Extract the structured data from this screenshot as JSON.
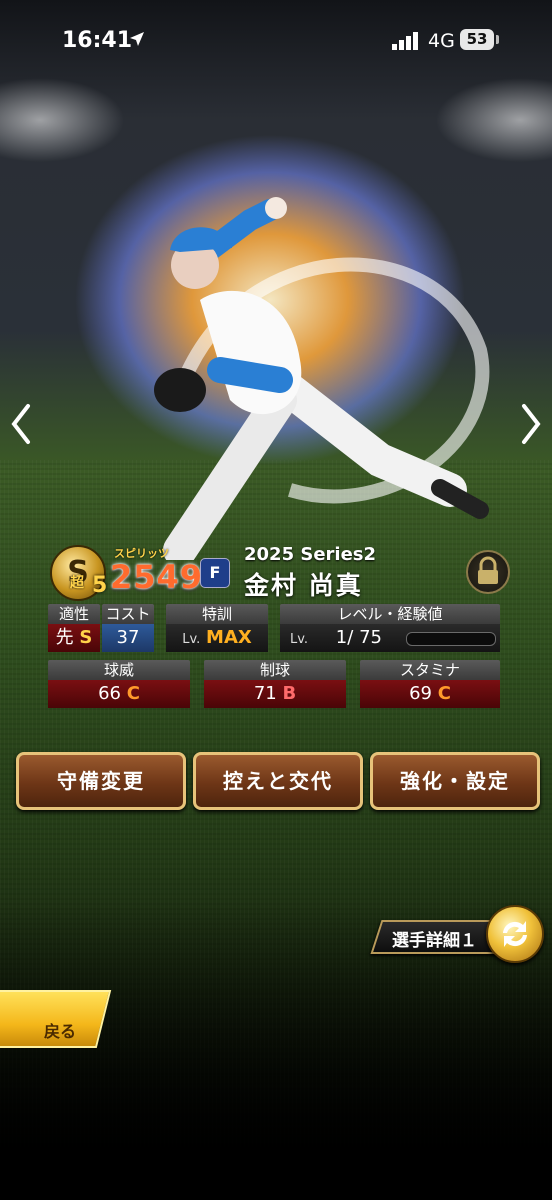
{
  "status_bar": {
    "time": "16:41",
    "network": "4G",
    "battery": "53"
  },
  "card": {
    "rank_letter": "S",
    "rank_sub": "超",
    "rank_number": "5",
    "spirits_label": "スピリッツ",
    "spirits_value": "2549",
    "team_logo": "F",
    "series": "2025 Series2",
    "player_name": "金村 尚真"
  },
  "stats": {
    "aptitude": {
      "label": "適性",
      "position": "先",
      "grade": "S"
    },
    "cost": {
      "label": "コスト",
      "value": "37"
    },
    "training": {
      "label": "特訓",
      "lv": "Lv.",
      "value": "MAX"
    },
    "level": {
      "label": "レベル・経験値",
      "lv": "Lv.",
      "current": "1",
      "separator": "/",
      "max": "75",
      "exp_fraction": 0.0
    },
    "velocity": {
      "label": "球威",
      "value": "66",
      "grade": "C"
    },
    "control": {
      "label": "制球",
      "value": "71",
      "grade": "B"
    },
    "stamina": {
      "label": "スタミナ",
      "value": "69",
      "grade": "C"
    }
  },
  "actions": {
    "defense_change": "守備変更",
    "substitute": "控えと交代",
    "enhance": "強化・設定"
  },
  "detail_button": "選手詳細１",
  "back_button": "戻る",
  "colors": {
    "spirits": "#ff6b2e",
    "button_border": "#e7c37a",
    "button_fill": "#6e3617",
    "stat_red": "#7a0f12",
    "stat_blue": "#2e5a9a"
  },
  "icons": {
    "prev": "chevron-left-icon",
    "next": "chevron-right-icon",
    "lock": "lock-icon",
    "swap": "swap-icon",
    "location": "location-arrow-icon",
    "signal": "signal-bars-icon"
  }
}
